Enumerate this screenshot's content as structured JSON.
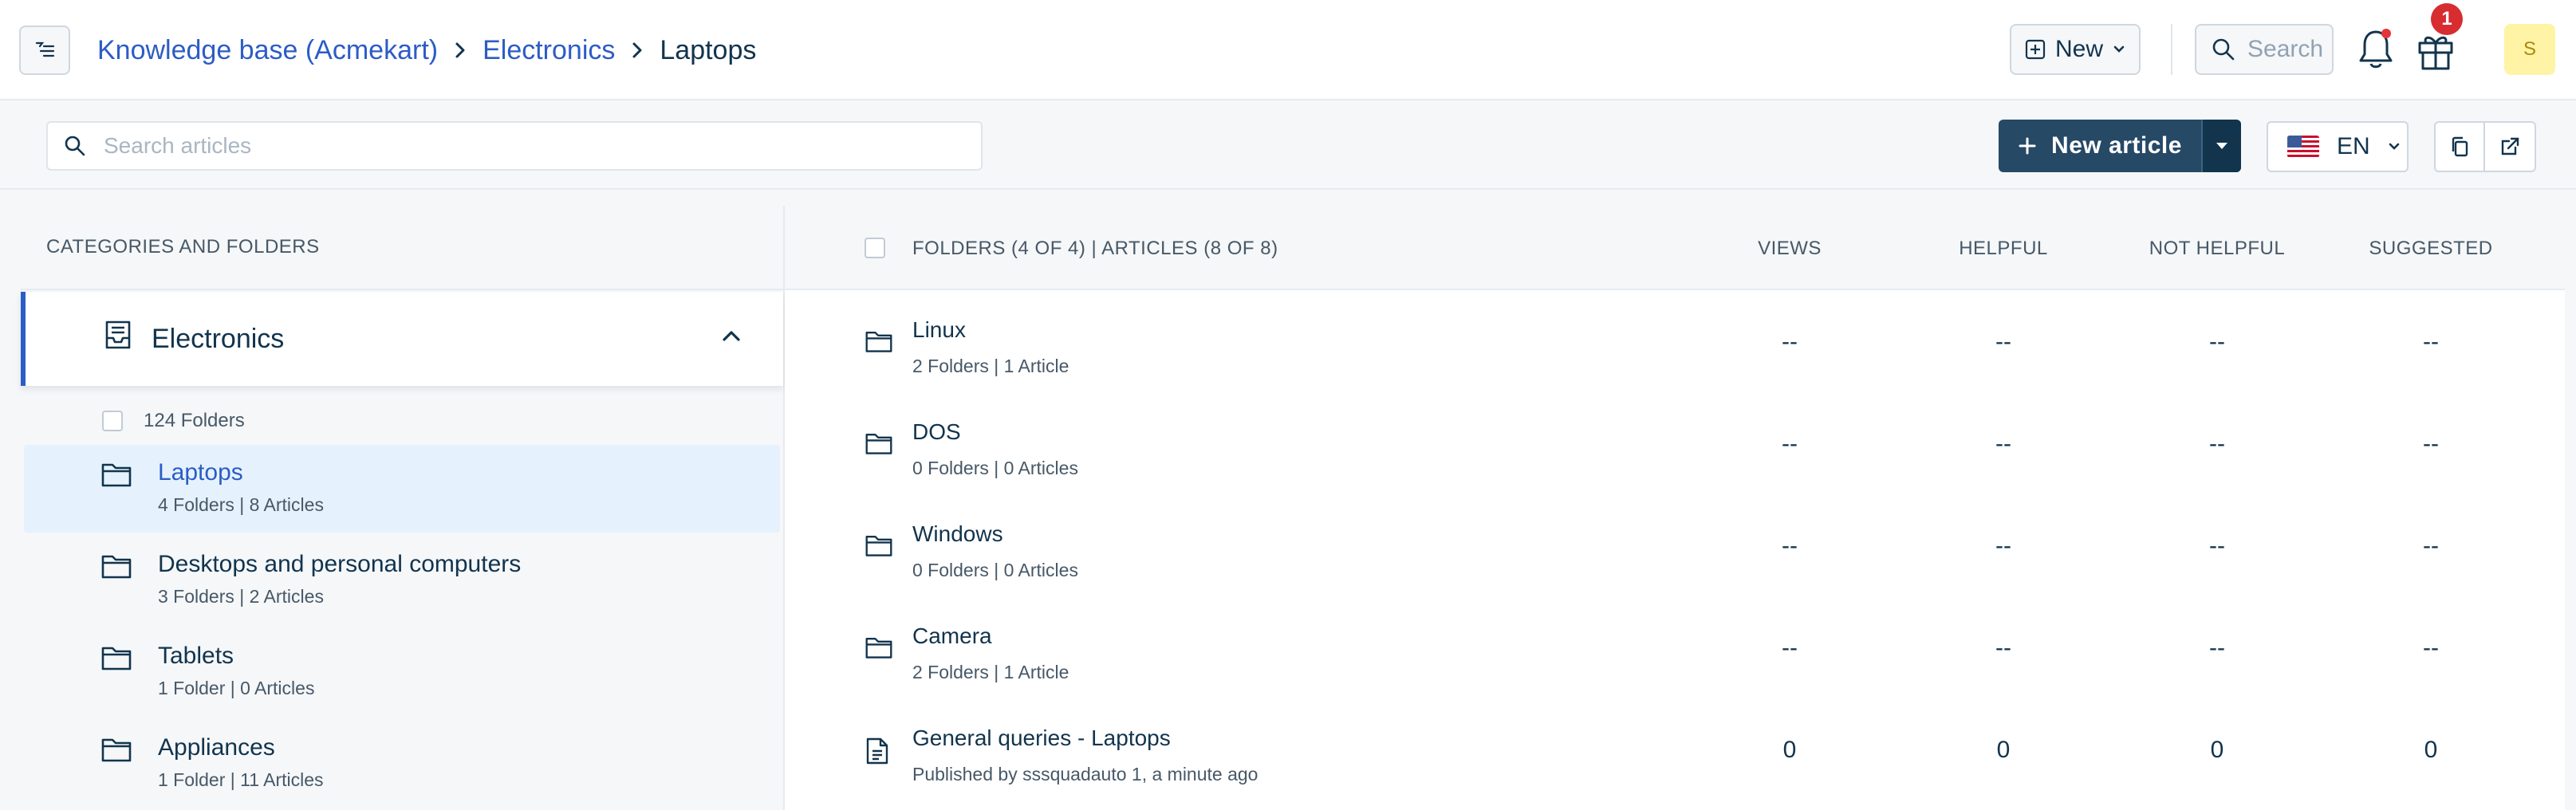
{
  "header": {
    "breadcrumb": {
      "root": "Knowledge base (Acmekart)",
      "parent": "Electronics",
      "current": "Laptops"
    },
    "new_label": "New",
    "search_placeholder": "Search",
    "gift_badge_count": "1",
    "avatar_initial": "S"
  },
  "toolbar": {
    "search_placeholder": "Search articles",
    "new_article_label": "New article",
    "language": "EN"
  },
  "sidebar": {
    "heading": "CATEGORIES AND FOLDERS",
    "category": "Electronics",
    "folder_count": "124 Folders",
    "folders": [
      {
        "name": "Laptops",
        "meta": "4 Folders | 8 Articles",
        "selected": true
      },
      {
        "name": "Desktops and personal computers",
        "meta": "3 Folders | 2 Articles",
        "selected": false
      },
      {
        "name": "Tablets",
        "meta": "1 Folder | 0 Articles",
        "selected": false
      },
      {
        "name": "Appliances",
        "meta": "1 Folder | 11 Articles",
        "selected": false
      }
    ]
  },
  "table": {
    "summary": "FOLDERS (4 OF 4) | ARTICLES (8 OF 8)",
    "columns": [
      "VIEWS",
      "HELPFUL",
      "NOT HELPFUL",
      "SUGGESTED"
    ],
    "rows": [
      {
        "type": "folder",
        "name": "Linux",
        "meta": "2 Folders | 1 Article",
        "values": [
          "--",
          "--",
          "--",
          "--"
        ]
      },
      {
        "type": "folder",
        "name": "DOS",
        "meta": "0 Folders | 0 Articles",
        "values": [
          "--",
          "--",
          "--",
          "--"
        ]
      },
      {
        "type": "folder",
        "name": "Windows",
        "meta": "0 Folders | 0 Articles",
        "values": [
          "--",
          "--",
          "--",
          "--"
        ]
      },
      {
        "type": "folder",
        "name": "Camera",
        "meta": "2 Folders | 1 Article",
        "values": [
          "--",
          "--",
          "--",
          "--"
        ]
      },
      {
        "type": "article",
        "name": "General queries - Laptops",
        "meta": "Published by sssquadauto 1, a minute ago",
        "values": [
          "0",
          "0",
          "0",
          "0"
        ]
      }
    ]
  },
  "colors": {
    "link": "#2c5cc5",
    "primary_button": "#264966",
    "selected_bg": "#e5f2fd",
    "badge": "#d72d30",
    "avatar_bg": "#fff3a6"
  }
}
